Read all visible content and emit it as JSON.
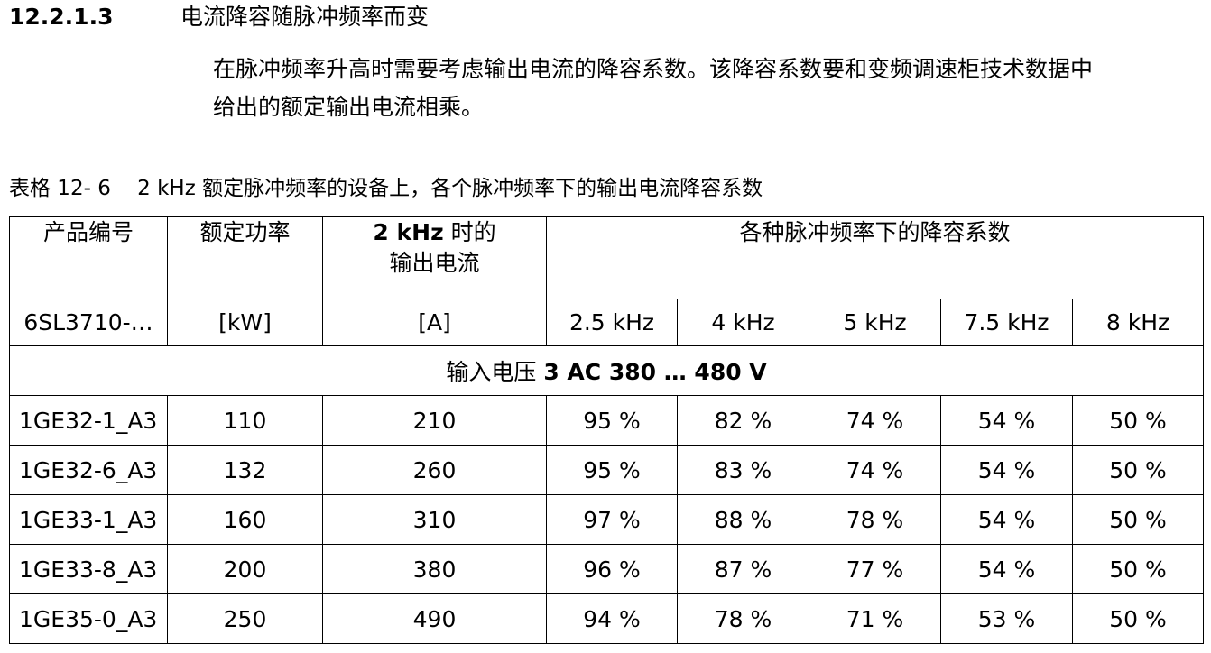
{
  "section": {
    "number": "12.2.1.3",
    "title": "电流降容随脉冲频率而变"
  },
  "intro": {
    "line1": "在脉冲频率升高时需要考虑输出电流的降容系数。该降容系数要和变频调速柜技术数据中",
    "line2": "给出的额定输出电流相乘。"
  },
  "table_caption": {
    "id": "表格 12- 6",
    "text": "2 kHz 额定脉冲频率的设备上，各个脉冲频率下的输出电流降容系数"
  },
  "table": {
    "headers": {
      "product_code": "产品编号",
      "rated_power": "额定功率",
      "output_current_bold": "2 kHz",
      "output_current_rest": " 时的",
      "output_current_line2": "输出电流",
      "derating_group": "各种脉冲频率下的降容系数"
    },
    "units": {
      "product_code": "6SL3710-…",
      "rated_power": "[kW]",
      "output_current": "[A]",
      "f1": "2.5 kHz",
      "f2": "4 kHz",
      "f3": "5 kHz",
      "f4": "7.5 kHz",
      "f5": "8 kHz"
    },
    "voltage_row": {
      "prefix": "输入电压 ",
      "value": "3 AC 380 … 480 V"
    },
    "rows": [
      {
        "code": "1GE32-1_A3",
        "power": "110",
        "current": "210",
        "f1": "95 %",
        "f2": "82 %",
        "f3": "74 %",
        "f4": "54 %",
        "f5": "50 %"
      },
      {
        "code": "1GE32-6_A3",
        "power": "132",
        "current": "260",
        "f1": "95 %",
        "f2": "83 %",
        "f3": "74 %",
        "f4": "54 %",
        "f5": "50 %"
      },
      {
        "code": "1GE33-1_A3",
        "power": "160",
        "current": "310",
        "f1": "97 %",
        "f2": "88 %",
        "f3": "78 %",
        "f4": "54 %",
        "f5": "50 %"
      },
      {
        "code": "1GE33-8_A3",
        "power": "200",
        "current": "380",
        "f1": "96 %",
        "f2": "87 %",
        "f3": "77 %",
        "f4": "54 %",
        "f5": "50 %"
      },
      {
        "code": "1GE35-0_A3",
        "power": "250",
        "current": "490",
        "f1": "94 %",
        "f2": "78 %",
        "f3": "71 %",
        "f4": "53 %",
        "f5": "50 %"
      }
    ]
  }
}
